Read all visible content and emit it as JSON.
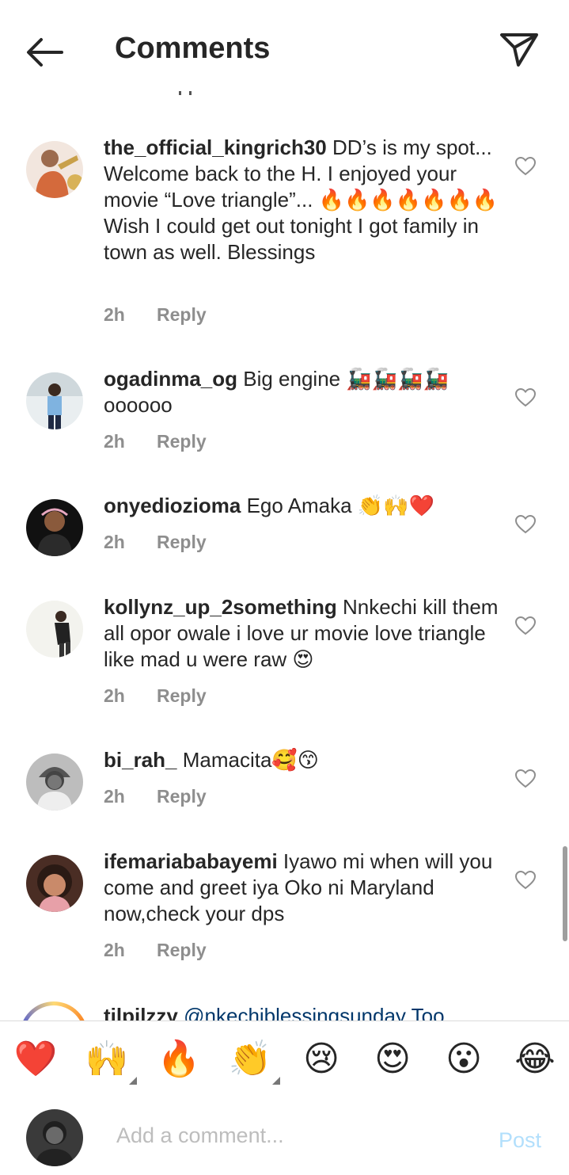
{
  "header": {
    "back_icon": "arrow-left-icon",
    "title": "Comments",
    "share_icon": "paper-plane-icon"
  },
  "comments": [
    {
      "username": "the_official_kingrich30",
      "text": " DD’s is my spot... Welcome back to the H. I enjoyed your movie “Love triangle”... 🔥🔥🔥🔥🔥🔥🔥 Wish I could get out tonight I got family in town as well. Blessings",
      "time": "2h",
      "reply_label": "Reply"
    },
    {
      "username": "ogadinma_og",
      "text": " Big engine 🚂🚂🚂🚂 oooooo",
      "time": "2h",
      "reply_label": "Reply"
    },
    {
      "username": "onyedioziоma",
      "text": " Ego Amaka 👏🙌❤️",
      "time": "2h",
      "reply_label": "Reply"
    },
    {
      "username": "kollynz_up_2something",
      "text": " Nnkechi kill them all opor owale i love ur movie love triangle like mad u were raw 😍",
      "time": "2h",
      "reply_label": "Reply"
    },
    {
      "username": "bi_rah_",
      "text": " Mamacita🥰😙",
      "time": "2h",
      "reply_label": "Reply"
    },
    {
      "username": "ifemariababayemi",
      "text": " Iyawo mi when will you come and greet iya Oko ni Maryland now,check your dps",
      "time": "2h",
      "reply_label": "Reply"
    },
    {
      "username": "tilpilzzy",
      "text": " @nkechiblessingsunday Too",
      "time": "",
      "reply_label": ""
    }
  ],
  "reactions": [
    "❤️",
    "🙌",
    "🔥",
    "👏",
    "😢",
    "😍",
    "😮",
    "😂"
  ],
  "composer": {
    "placeholder": "Add a comment...",
    "post_label": "Post"
  },
  "colors": {
    "text": "#262626",
    "meta": "#8e8e8e",
    "post_disabled": "#b2dffc",
    "divider": "#dbdbdb"
  }
}
